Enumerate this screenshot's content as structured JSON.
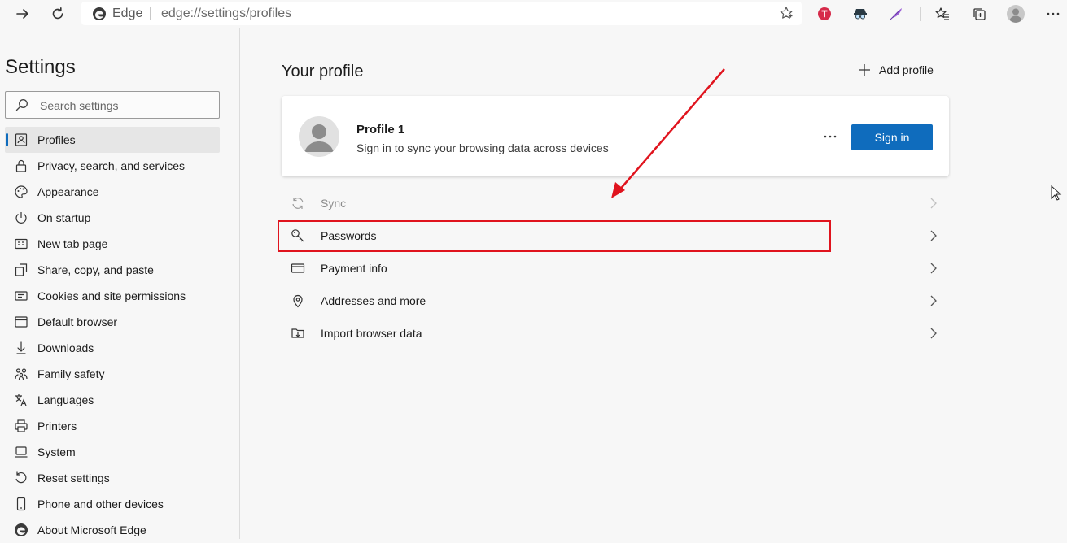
{
  "toolbar": {
    "address_app": "Edge",
    "address_url": "edge://settings/profiles"
  },
  "sidebar": {
    "title": "Settings",
    "search_placeholder": "Search settings",
    "items": [
      {
        "label": "Profiles",
        "icon": "profiles-icon",
        "active": true
      },
      {
        "label": "Privacy, search, and services",
        "icon": "lock-icon"
      },
      {
        "label": "Appearance",
        "icon": "palette-icon"
      },
      {
        "label": "On startup",
        "icon": "power-icon"
      },
      {
        "label": "New tab page",
        "icon": "new-tab-icon"
      },
      {
        "label": "Share, copy, and paste",
        "icon": "share-icon"
      },
      {
        "label": "Cookies and site permissions",
        "icon": "cookies-icon"
      },
      {
        "label": "Default browser",
        "icon": "browser-icon"
      },
      {
        "label": "Downloads",
        "icon": "download-icon"
      },
      {
        "label": "Family safety",
        "icon": "family-icon"
      },
      {
        "label": "Languages",
        "icon": "languages-icon"
      },
      {
        "label": "Printers",
        "icon": "printer-icon"
      },
      {
        "label": "System",
        "icon": "system-icon"
      },
      {
        "label": "Reset settings",
        "icon": "reset-icon"
      },
      {
        "label": "Phone and other devices",
        "icon": "phone-icon"
      },
      {
        "label": "About Microsoft Edge",
        "icon": "edge-icon"
      }
    ]
  },
  "main": {
    "title": "Your profile",
    "add_profile_label": "Add profile",
    "profile": {
      "name": "Profile 1",
      "subtitle": "Sign in to sync your browsing data across devices",
      "more_label": "⋯",
      "sign_in_label": "Sign in"
    },
    "rows": [
      {
        "label": "Sync",
        "icon": "sync-icon",
        "disabled": true
      },
      {
        "label": "Passwords",
        "icon": "key-icon",
        "highlighted": true
      },
      {
        "label": "Payment info",
        "icon": "credit-card-icon"
      },
      {
        "label": "Addresses and more",
        "icon": "location-pin-icon"
      },
      {
        "label": "Import browser data",
        "icon": "import-icon"
      }
    ]
  },
  "colors": {
    "accent": "#0f6cbd",
    "annotation": "#e0141e"
  }
}
